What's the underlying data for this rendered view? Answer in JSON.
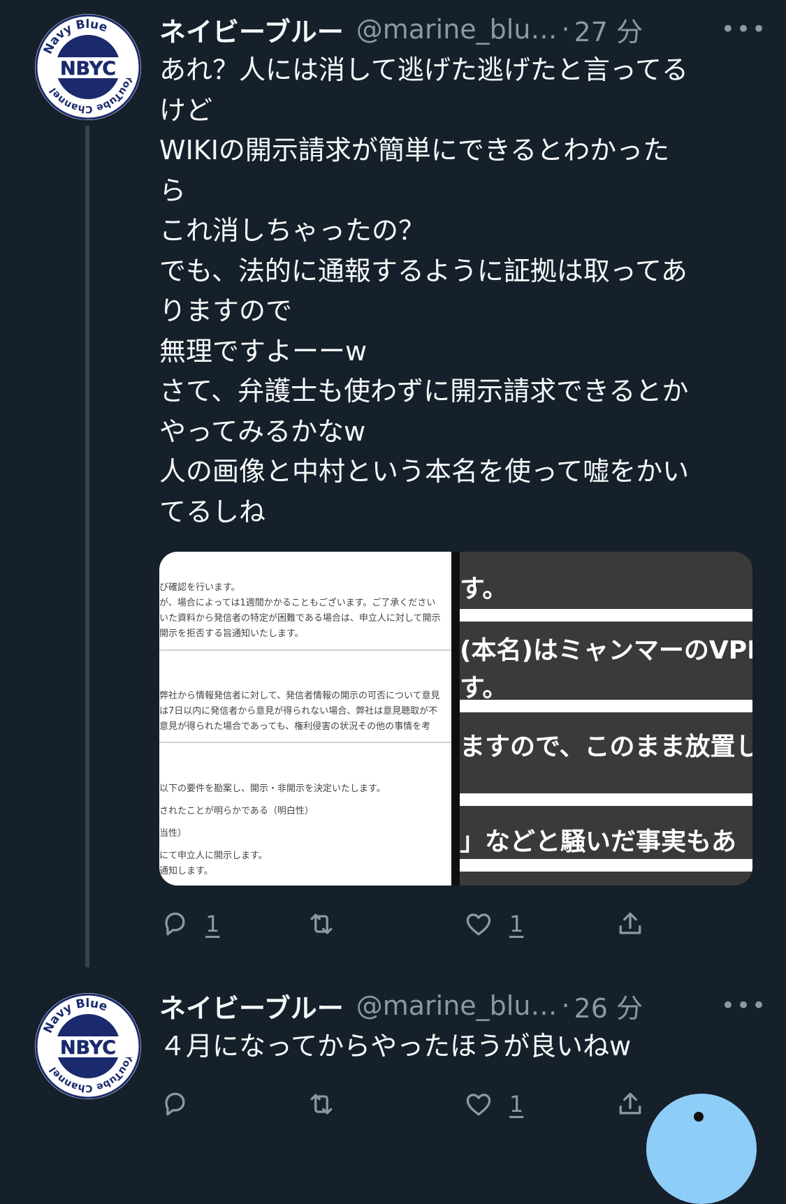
{
  "tweets": [
    {
      "name": "ネイビーブルー",
      "handle": "@marine_blu…",
      "time": "27 分",
      "text": "あれ？人には消して逃げた逃げたと言ってる\nけど\nWIKIの開示請求が簡単にできるとわかった\nら\nこれ消しちゃったの？\nでも、法的に通報するように証拠は取ってあ\nりますので\n無理ですよーーw\nさて、弁護士も使わずに開示請求できるとか\nやってみるかなw\n人の画像と中村という本名を使って嘘をかい\nてるしね",
      "avatar": {
        "text_top": "Navy Blue",
        "text_center": "NBYC",
        "text_side": "YouTube Channel"
      },
      "media": {
        "left_lines": [
          "び確認を行います。",
          "が、場合によっては1週間かかることもございます。ご了承ください",
          "いた資料から発信者の特定が困難である場合は、申立人に対して開示",
          "開示を拒否する旨通知いたします。",
          "弊社から情報発信者に対して、発信者情報の開示の可否について意見",
          "は7日以内に発信者から意見が得られない場合、弊社は意見聴取が不",
          "意見が得られた場合であっても、権利侵害の状況その他の事情を考",
          "以下の要件を勘案し、開示・非開示を決定いたします。",
          "されたことが明らかである（明白性）",
          "当性）",
          "にて申立人に開示します。",
          "通知します。"
        ],
        "right_lines": [
          "す。",
          "(本名)はミャンマーのVPN",
          "す。",
          "ますので、このまま放置し",
          "」などと騒いだ事実もあ"
        ]
      },
      "actions": {
        "reply_count": "1",
        "retweet_count": "",
        "like_count": "1"
      }
    },
    {
      "name": "ネイビーブルー",
      "handle": "@marine_blu…",
      "time": "26 分",
      "text": "４月になってからやったほうが良いねw",
      "avatar": {
        "text_top": "Navy Blue",
        "text_center": "NBYC",
        "text_side": "YouTube Channel"
      },
      "actions": {
        "reply_count": "",
        "retweet_count": "",
        "like_count": "1"
      }
    }
  ],
  "icons": {
    "reply": "reply-icon",
    "retweet": "retweet-icon",
    "like": "like-icon",
    "share": "share-icon",
    "more": "more-icon"
  },
  "colors": {
    "background": "#15202b",
    "text": "#f7f9f9",
    "muted": "#8b98a5",
    "accent": "#8ecdf8",
    "logo_navy": "#1a2a6c"
  }
}
